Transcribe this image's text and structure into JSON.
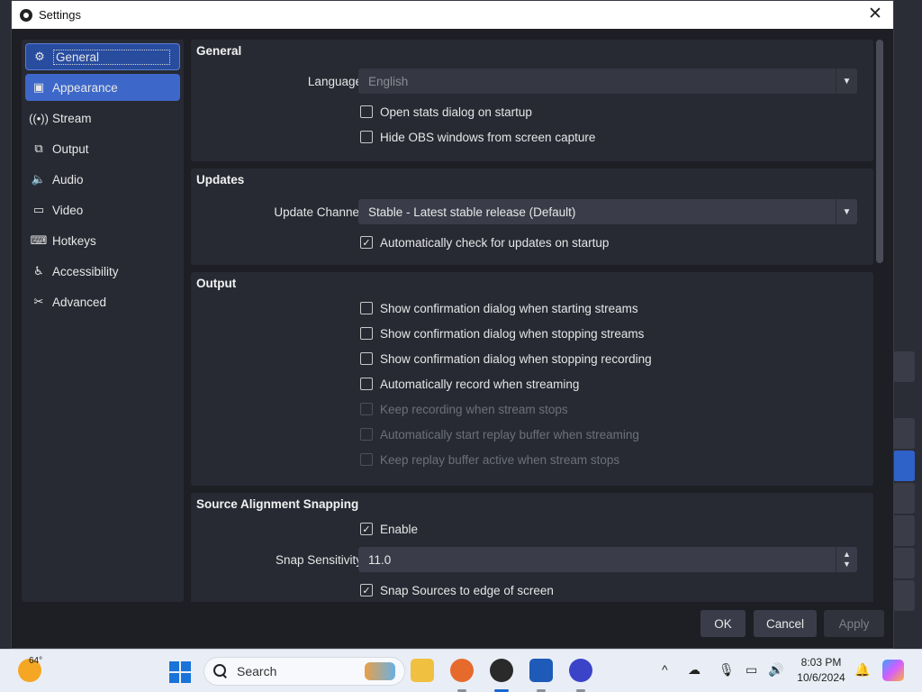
{
  "window": {
    "title": "Settings"
  },
  "sidebar": {
    "items": [
      {
        "label": "General",
        "icon": "gear-icon"
      },
      {
        "label": "Appearance",
        "icon": "palette-icon"
      },
      {
        "label": "Stream",
        "icon": "broadcast-icon"
      },
      {
        "label": "Output",
        "icon": "output-icon"
      },
      {
        "label": "Audio",
        "icon": "speaker-icon"
      },
      {
        "label": "Video",
        "icon": "monitor-icon"
      },
      {
        "label": "Hotkeys",
        "icon": "keyboard-icon"
      },
      {
        "label": "Accessibility",
        "icon": "accessibility-icon"
      },
      {
        "label": "Advanced",
        "icon": "tools-icon"
      }
    ]
  },
  "general": {
    "title": "General",
    "language_label": "Language",
    "language_value": "English",
    "open_stats": "Open stats dialog on startup",
    "hide_obs": "Hide OBS windows from screen capture"
  },
  "updates": {
    "title": "Updates",
    "channel_label": "Update Channel",
    "channel_value": "Stable - Latest stable release (Default)",
    "auto_check": "Automatically check for updates on startup"
  },
  "output": {
    "title": "Output",
    "confirm_start": "Show confirmation dialog when starting streams",
    "confirm_stop": "Show confirmation dialog when stopping streams",
    "confirm_stop_rec": "Show confirmation dialog when stopping recording",
    "auto_record": "Automatically record when streaming",
    "keep_recording": "Keep recording when stream stops",
    "auto_replay": "Automatically start replay buffer when streaming",
    "keep_replay": "Keep replay buffer active when stream stops"
  },
  "snapping": {
    "title": "Source Alignment Snapping",
    "enable": "Enable",
    "sensitivity_label": "Snap Sensitivity",
    "sensitivity_value": "11.0",
    "snap_edge": "Snap Sources to edge of screen"
  },
  "buttons": {
    "ok": "OK",
    "cancel": "Cancel",
    "apply": "Apply"
  },
  "taskbar": {
    "temperature": "64°",
    "search_placeholder": "Search",
    "time": "8:03 PM",
    "date": "10/6/2024"
  },
  "colors": {
    "accent": "#284c9e",
    "hover": "#3d68c9",
    "panel": "#272a33",
    "background": "#1e1f25"
  }
}
